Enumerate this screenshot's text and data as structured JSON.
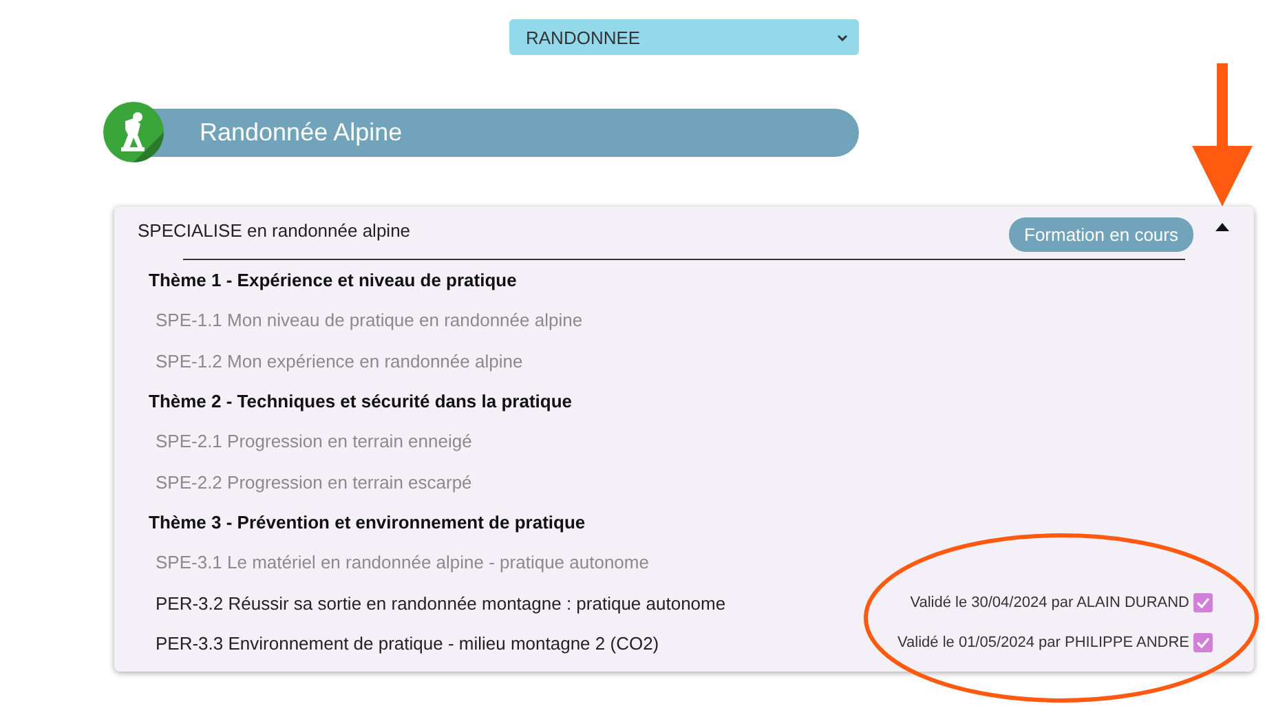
{
  "activity_select": {
    "value": "RANDONNEE"
  },
  "banner": {
    "title": "Randonnée Alpine"
  },
  "training": {
    "title": "SPECIALISE en randonnée alpine",
    "status": "Formation en cours",
    "expanded": true,
    "items": [
      {
        "kind": "theme",
        "label": "Thème 1 - Expérience et niveau de pratique"
      },
      {
        "kind": "skill",
        "label": "SPE-1.1 Mon niveau de pratique en randonnée alpine",
        "validated": false
      },
      {
        "kind": "skill",
        "label": "SPE-1.2 Mon expérience en randonnée alpine",
        "validated": false
      },
      {
        "kind": "theme",
        "label": "Thème 2 - Techniques et sécurité dans la pratique"
      },
      {
        "kind": "skill",
        "label": "SPE-2.1 Progression en terrain enneigé",
        "validated": false
      },
      {
        "kind": "skill",
        "label": "SPE-2.2 Progression en terrain escarpé",
        "validated": false
      },
      {
        "kind": "theme",
        "label": "Thème 3 - Prévention et environnement de pratique"
      },
      {
        "kind": "skill",
        "label": "SPE-3.1 Le matériel en randonnée alpine - pratique autonome",
        "validated": false
      },
      {
        "kind": "skill",
        "label": "PER-3.2 Réussir sa sortie en randonnée montagne : pratique autonome",
        "validated": true,
        "validation": "Validé le 30/04/2024 par ALAIN DURAND"
      },
      {
        "kind": "skill",
        "label": "PER-3.3 Environnement de pratique - milieu montagne 2 (CO2)",
        "validated": true,
        "validation": "Validé le 01/05/2024 par PHILIPPE ANDRE"
      }
    ]
  }
}
